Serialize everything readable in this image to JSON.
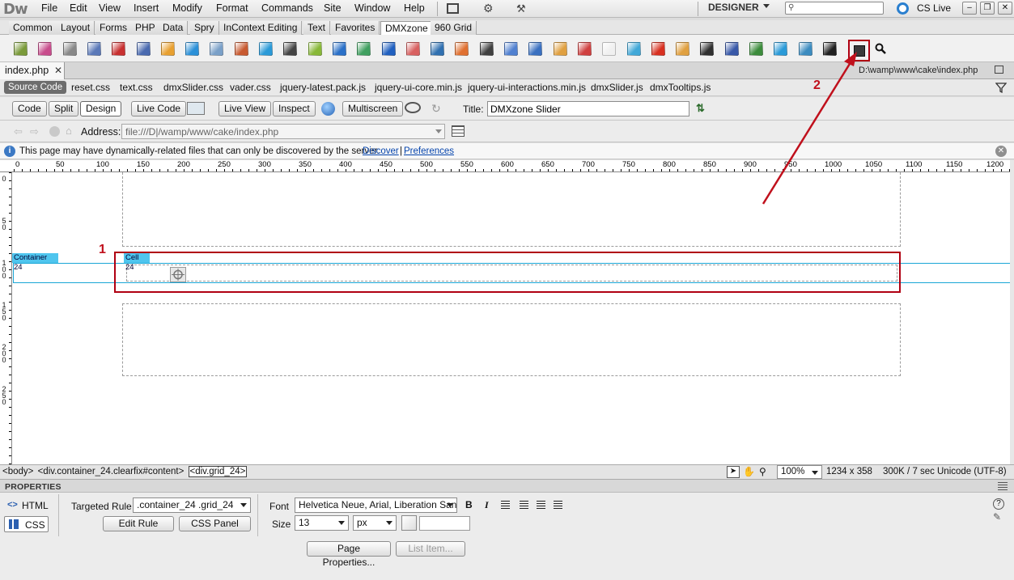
{
  "app": {
    "logo": "Dw",
    "menu": [
      "File",
      "Edit",
      "View",
      "Insert",
      "Modify",
      "Format",
      "Commands",
      "Site",
      "Window",
      "Help"
    ],
    "workspace": "DESIGNER",
    "cs_live": "CS Live"
  },
  "insert_tabs": [
    "Common",
    "Layout",
    "Forms",
    "PHP",
    "Data",
    "Spry",
    "InContext Editing",
    "Text",
    "Favorites",
    "DMXzone",
    "960 Grid"
  ],
  "insert_active_tab": "DMXzone",
  "toolbar_icon_colors": [
    "#7a9a3a",
    "#c84c8c",
    "#888888",
    "#5a78b8",
    "#c83030",
    "#4a6ab0",
    "#e8a030",
    "#2a90d8",
    "#7aa0c8",
    "#c85a30",
    "#2a9ad8",
    "#444444",
    "#88b838",
    "#2a70c8",
    "#40a060",
    "#2060c0",
    "#d86060",
    "#3070b0",
    "#e07030",
    "#404040",
    "#5080d0",
    "#3a70c0",
    "#e0a040",
    "#d04040",
    "#f0f0f0",
    "#40a8d8",
    "#d83020",
    "#e0a040",
    "#303030",
    "#3858a8",
    "#3c8c3c",
    "#2a9ad8",
    "#3c8cc0",
    "#202020"
  ],
  "document": {
    "tab_name": "index.php",
    "path": "D:\\wamp\\www\\cake\\index.php",
    "related_files": [
      "Source Code",
      "reset.css",
      "text.css",
      "dmxSlider.css",
      "vader.css",
      "jquery-latest.pack.js",
      "jquery-ui-core.min.js",
      "jquery-ui-interactions.min.js",
      "dmxSlider.js",
      "dmxTooltips.js"
    ],
    "view_buttons": [
      "Code",
      "Split",
      "Design"
    ],
    "active_view": "Design",
    "live_code": "Live Code",
    "live_view": "Live View",
    "inspect": "Inspect",
    "multiscreen": "Multiscreen",
    "title_label": "Title:",
    "title_value": "DMXzone Slider",
    "address_label": "Address:",
    "address_value": "file:///D|/wamp/www/cake/index.php"
  },
  "info_bar": {
    "message": "This page may have dynamically-related files that can only be discovered by the server.",
    "discover": "Discover",
    "separator": "|",
    "preferences": "Preferences"
  },
  "rulers": {
    "top": [
      "0",
      "50",
      "100",
      "150",
      "200",
      "250",
      "300",
      "350",
      "400",
      "450",
      "500",
      "550",
      "600",
      "650",
      "700",
      "750",
      "800",
      "850",
      "900",
      "950",
      "1000",
      "1050",
      "1100",
      "1150",
      "1200"
    ],
    "left": [
      "0",
      "5 0",
      "1 0 0",
      "1 5 0",
      "2 0 0",
      "2 5 0"
    ]
  },
  "design": {
    "container_label": "Container 24",
    "cell_label": "Cell 24",
    "annotation_1": "1",
    "annotation_2": "2"
  },
  "status_bar": {
    "tags": [
      "<body>",
      "<div.container_24.clearfix#content>",
      "<div.grid_24>"
    ],
    "zoom": "100%",
    "dimensions": "1234 x 358",
    "download": "300K / 7 sec",
    "encoding": "Unicode (UTF-8)"
  },
  "properties": {
    "title": "PROPERTIES",
    "html_tab": "HTML",
    "css_tab": "CSS",
    "targeted_rule_label": "Targeted Rule",
    "targeted_rule_value": ".container_24 .grid_24",
    "edit_rule": "Edit Rule",
    "css_panel": "CSS Panel",
    "font_label": "Font",
    "font_value": "Helvetica Neue, Arial, Liberation Sans",
    "size_label": "Size",
    "size_value": "13",
    "unit_value": "px",
    "bold": "B",
    "italic": "I",
    "page_properties": "Page Properties...",
    "list_item": "List Item..."
  },
  "colors": {
    "accent_red": "#b00012",
    "guide_blue": "#1aa6d6",
    "label_blue": "#4fc5ee",
    "link_blue": "#0645ad"
  }
}
